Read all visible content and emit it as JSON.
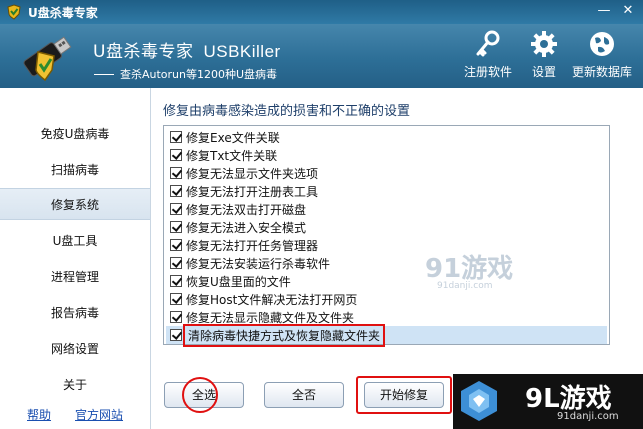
{
  "window": {
    "title": "U盘杀毒专家",
    "minimize_glyph": "—",
    "close_glyph": "✕"
  },
  "header": {
    "brand_cn": "U盘杀毒专家",
    "brand_en": "USBKiller",
    "subtitle": "查杀Autorun等1200种U盘病毒",
    "tools": [
      {
        "label": "注册软件",
        "icon": "key-icon"
      },
      {
        "label": "设置",
        "icon": "gear-icon"
      },
      {
        "label": "更新数据库",
        "icon": "globe-update-icon"
      }
    ]
  },
  "sidebar": {
    "items": [
      {
        "label": "免疫U盘病毒"
      },
      {
        "label": "扫描病毒"
      },
      {
        "label": "修复系统",
        "active": true
      },
      {
        "label": "U盘工具"
      },
      {
        "label": "进程管理"
      },
      {
        "label": "报告病毒"
      },
      {
        "label": "网络设置"
      },
      {
        "label": "关于"
      }
    ],
    "links": {
      "help": "帮助",
      "website": "官方网站"
    }
  },
  "main": {
    "title": "修复由病毒感染造成的损害和不正确的设置",
    "options": [
      {
        "label": "修复Exe文件关联",
        "checked": true
      },
      {
        "label": "修复Txt文件关联",
        "checked": true
      },
      {
        "label": "修复无法显示文件夹选项",
        "checked": true
      },
      {
        "label": "修复无法打开注册表工具",
        "checked": true
      },
      {
        "label": "修复无法双击打开磁盘",
        "checked": true
      },
      {
        "label": "修复无法进入安全模式",
        "checked": true
      },
      {
        "label": "修复无法打开任务管理器",
        "checked": true
      },
      {
        "label": "修复无法安装运行杀毒软件",
        "checked": true
      },
      {
        "label": "恢复U盘里面的文件",
        "checked": true
      },
      {
        "label": "修复Host文件解决无法打开网页",
        "checked": true
      },
      {
        "label": "修复无法显示隐藏文件及文件夹",
        "checked": true
      },
      {
        "label": "清除病毒快捷方式及恢复隐藏文件夹",
        "checked": true,
        "selected": true
      }
    ],
    "buttons": {
      "select_all": "全选",
      "select_none": "全否",
      "start_fix": "开始修复"
    }
  },
  "watermark": {
    "brand": "9L游戏",
    "domain": "91danji.com",
    "mid_brand": "91游戏",
    "mid_domain": "91danji.com"
  },
  "colors": {
    "header_blue": "#2d6f97",
    "title_blue": "#1e3f6a",
    "selection": "#cfe3f5",
    "annotation_red": "#e01010"
  }
}
